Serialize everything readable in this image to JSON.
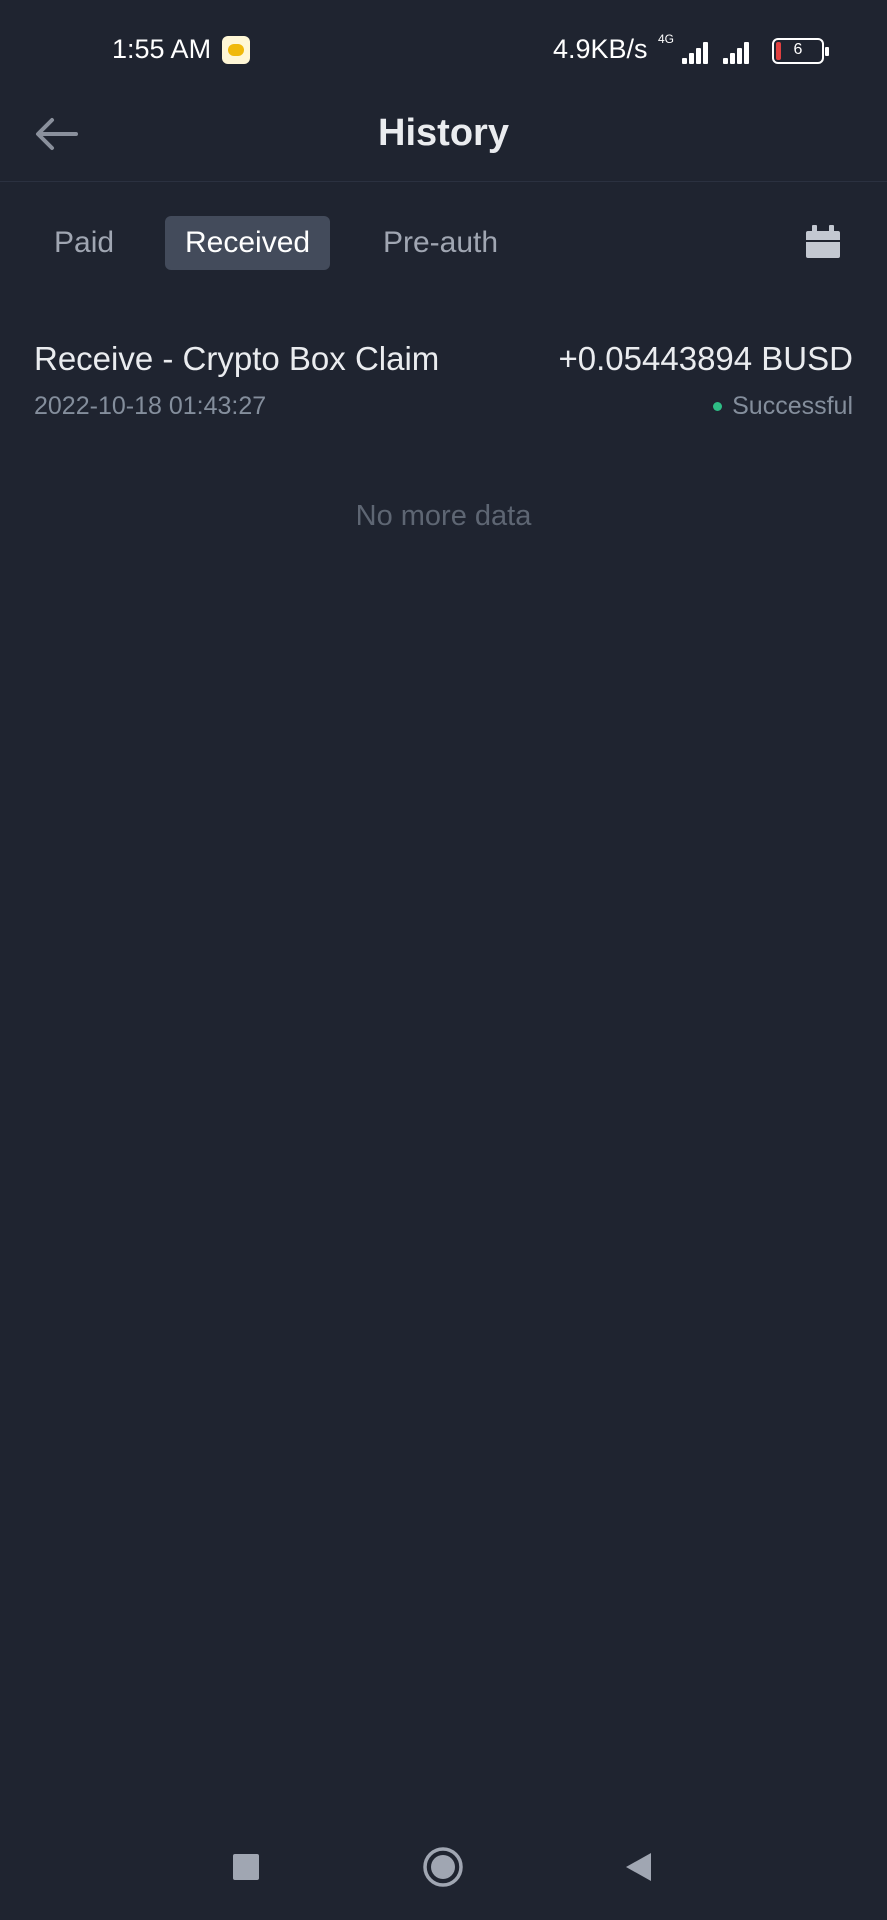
{
  "status_bar": {
    "time": "1:55 AM",
    "app_icon": "bee-notification-icon",
    "speed": "4.9KB/s",
    "network_type": "4G",
    "battery_level": "6"
  },
  "header": {
    "title": "History",
    "back_icon": "arrow-left-icon"
  },
  "tabs": [
    {
      "label": "Paid",
      "selected": false
    },
    {
      "label": "Received",
      "selected": true
    },
    {
      "label": "Pre-auth",
      "selected": false
    }
  ],
  "filter_icon": "calendar-icon",
  "transactions": [
    {
      "title": "Receive - Crypto Box Claim",
      "amount": "+0.05443894 BUSD",
      "datetime": "2022-10-18 01:43:27",
      "status": "Successful",
      "status_color": "#2ebd85"
    }
  ],
  "no_more_text": "No more data",
  "nav_bar": {
    "recent_icon": "square-recents-icon",
    "home_icon": "circle-home-icon",
    "back_icon": "triangle-back-icon"
  },
  "colors": {
    "background": "#1f2430",
    "selected_tab": "#434b5b",
    "success": "#2ebd85"
  }
}
